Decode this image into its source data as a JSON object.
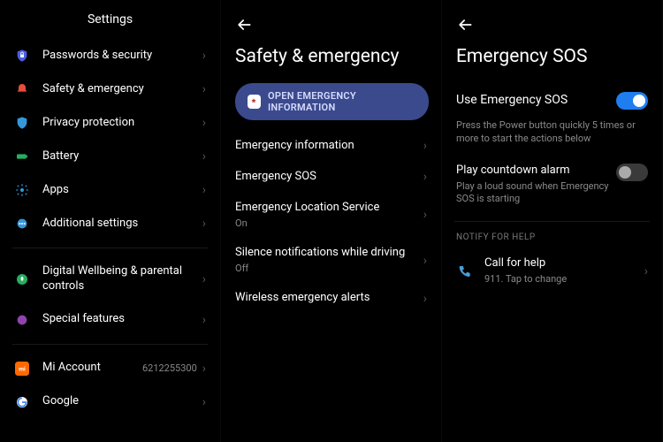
{
  "panel1": {
    "title": "Settings",
    "rows": [
      {
        "label": "Passwords & security"
      },
      {
        "label": "Safety & emergency"
      },
      {
        "label": "Privacy protection"
      },
      {
        "label": "Battery"
      },
      {
        "label": "Apps"
      },
      {
        "label": "Additional settings"
      }
    ],
    "rows2": [
      {
        "label": "Digital Wellbeing & parental controls"
      },
      {
        "label": "Special features"
      }
    ],
    "rows3": [
      {
        "label": "Mi Account",
        "right": "6212255300"
      },
      {
        "label": "Google"
      }
    ]
  },
  "panel2": {
    "title": "Safety & emergency",
    "pill": "OPEN EMERGENCY INFORMATION",
    "rows": [
      {
        "label": "Emergency information"
      },
      {
        "label": "Emergency SOS"
      },
      {
        "label": "Emergency Location Service",
        "sub": "On"
      },
      {
        "label": "Silence notifications while driving",
        "sub": "Off"
      },
      {
        "label": "Wireless emergency alerts"
      }
    ]
  },
  "panel3": {
    "title": "Emergency SOS",
    "use_label": "Use Emergency SOS",
    "use_desc": "Press the Power button quickly 5 times or more to start the actions below",
    "countdown_label": "Play countdown alarm",
    "countdown_sub": "Play a loud sound when Emergency SOS is starting",
    "section": "NOTIFY FOR HELP",
    "call_label": "Call for help",
    "call_sub": "911. Tap to change"
  }
}
